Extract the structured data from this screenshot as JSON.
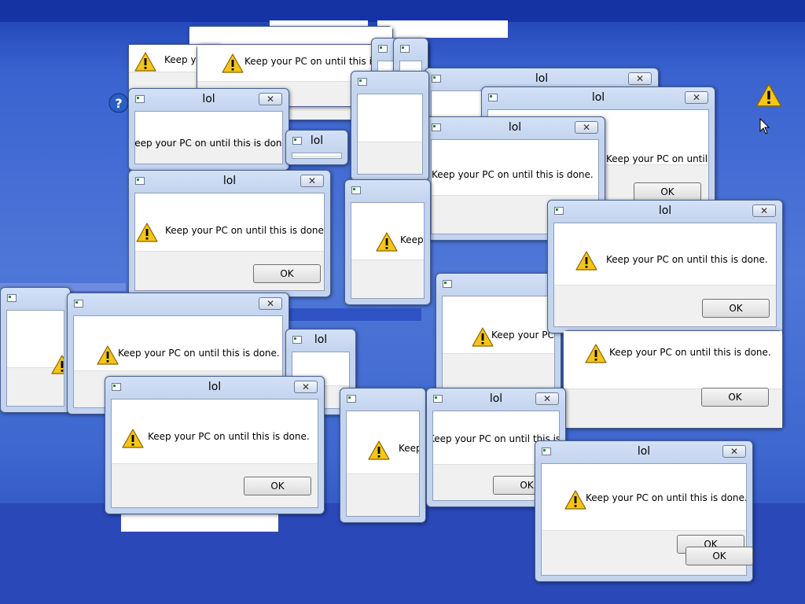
{
  "window": {
    "title": "lol",
    "message": "Keep your PC on until this is done.",
    "ok_label": "OK",
    "close_glyph": "✕"
  },
  "icons": {
    "warning": "warning-icon",
    "help": "help-icon",
    "close": "close-icon",
    "system": "window-system-icon",
    "cursor": "mouse-pointer-icon"
  },
  "colors": {
    "desktop_top": "#1c40b0",
    "desktop_mid": "#4f77d8",
    "frame": "#c4d4ee",
    "dialog_body": "#ffffff",
    "dialog_footer": "#f0f0f0",
    "warning_fill": "#f5c518"
  }
}
